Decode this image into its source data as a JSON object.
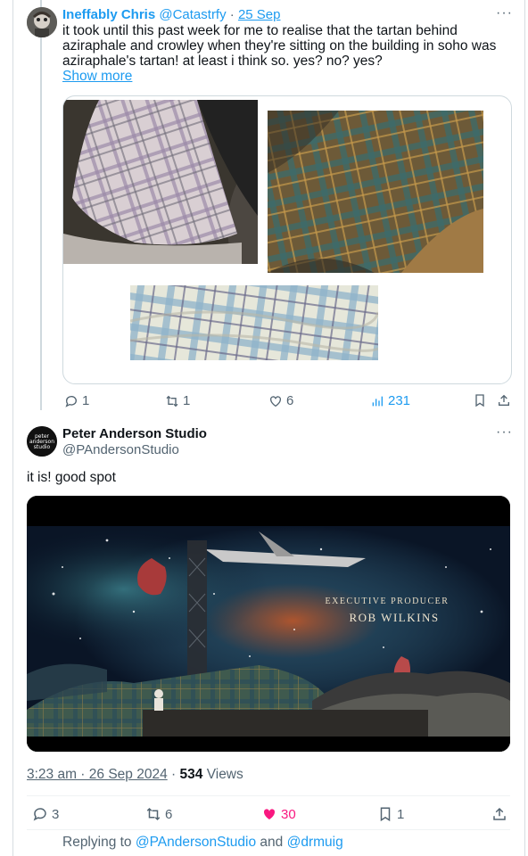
{
  "tweet1": {
    "name": "Ineffably Chris",
    "handle": "@Catastrfy",
    "dot": "·",
    "date": "25 Sep",
    "text": "it took until this past week for me to realise that the tartan behind aziraphale and crowley when they're sitting on the building in soho was aziraphale's tartan! at least i think so. yes? no? yes?",
    "show_more": "Show more",
    "more": "···",
    "replies": "1",
    "retweets": "1",
    "likes": "6",
    "views": "231"
  },
  "tweet2": {
    "name": "Peter Anderson Studio",
    "handle": "@PAndersonStudio",
    "avatar_text": "peter anderson studio",
    "more": "···",
    "body": "it is! good spot",
    "video": {
      "credit_role": "Executive Producer",
      "credit_name": "ROB WILKINS"
    },
    "time": "3:23 am · 26 Sep 2024",
    "dot": "·",
    "views_count": "534",
    "views_label": "Views",
    "replies": "3",
    "retweets": "6",
    "likes": "30",
    "bookmarks": "1"
  },
  "reply_bar": {
    "prefix": "Replying to",
    "user1": "@PAndersonStudio",
    "and": "and",
    "user2": "@drmuig"
  },
  "colors": {
    "accent": "#1d9bf0",
    "like": "#f91880",
    "muted": "#536471"
  }
}
